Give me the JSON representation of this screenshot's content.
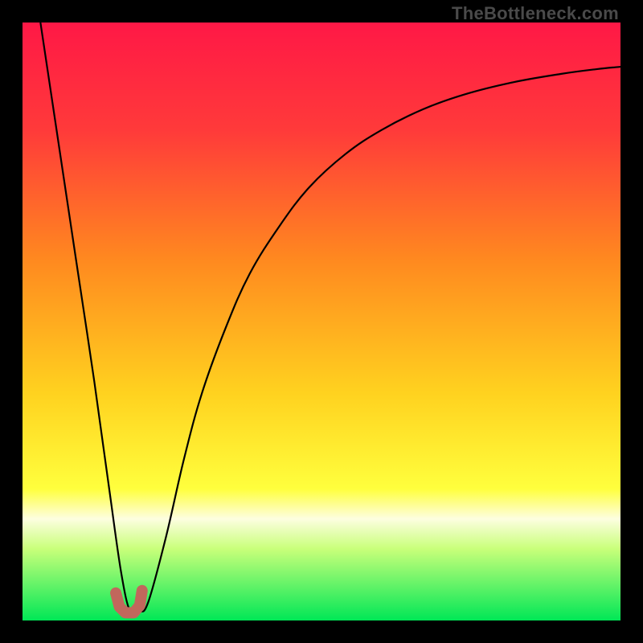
{
  "watermark": "TheBottleneck.com",
  "chart_data": {
    "type": "line",
    "title": "",
    "xlabel": "",
    "ylabel": "",
    "xlim": [
      0,
      100
    ],
    "ylim": [
      0,
      100
    ],
    "background_gradient": {
      "stops": [
        {
          "offset": 0,
          "color": "#ff1846"
        },
        {
          "offset": 18,
          "color": "#ff3a3a"
        },
        {
          "offset": 40,
          "color": "#ff8a1f"
        },
        {
          "offset": 62,
          "color": "#ffd21f"
        },
        {
          "offset": 78,
          "color": "#ffff3d"
        },
        {
          "offset": 83,
          "color": "#fdfee0"
        },
        {
          "offset": 88,
          "color": "#c9ff7a"
        },
        {
          "offset": 100,
          "color": "#00e756"
        }
      ]
    },
    "series": [
      {
        "name": "bottleneck-curve",
        "color": "#000000",
        "stroke_width": 2.2,
        "x": [
          3,
          6,
          9,
          12,
          14.5,
          16.5,
          18,
          19.5,
          21,
          24,
          27,
          30,
          34,
          38,
          43,
          48,
          54,
          60,
          67,
          74,
          82,
          90,
          96,
          100
        ],
        "y": [
          100,
          80,
          60,
          40,
          22,
          8,
          1.5,
          1.5,
          3,
          14,
          27,
          38,
          49,
          58,
          66,
          72.5,
          78,
          82,
          85.5,
          88,
          90,
          91.4,
          92.2,
          92.6
        ]
      },
      {
        "name": "optimal-marker",
        "type": "path",
        "color": "#c1675c",
        "stroke_width": 14,
        "linecap": "round",
        "x": [
          15.6,
          16.2,
          17.2,
          18.6,
          19.6,
          20.0
        ],
        "y": [
          4.6,
          2.3,
          1.3,
          1.3,
          2.5,
          5.0
        ]
      }
    ]
  }
}
